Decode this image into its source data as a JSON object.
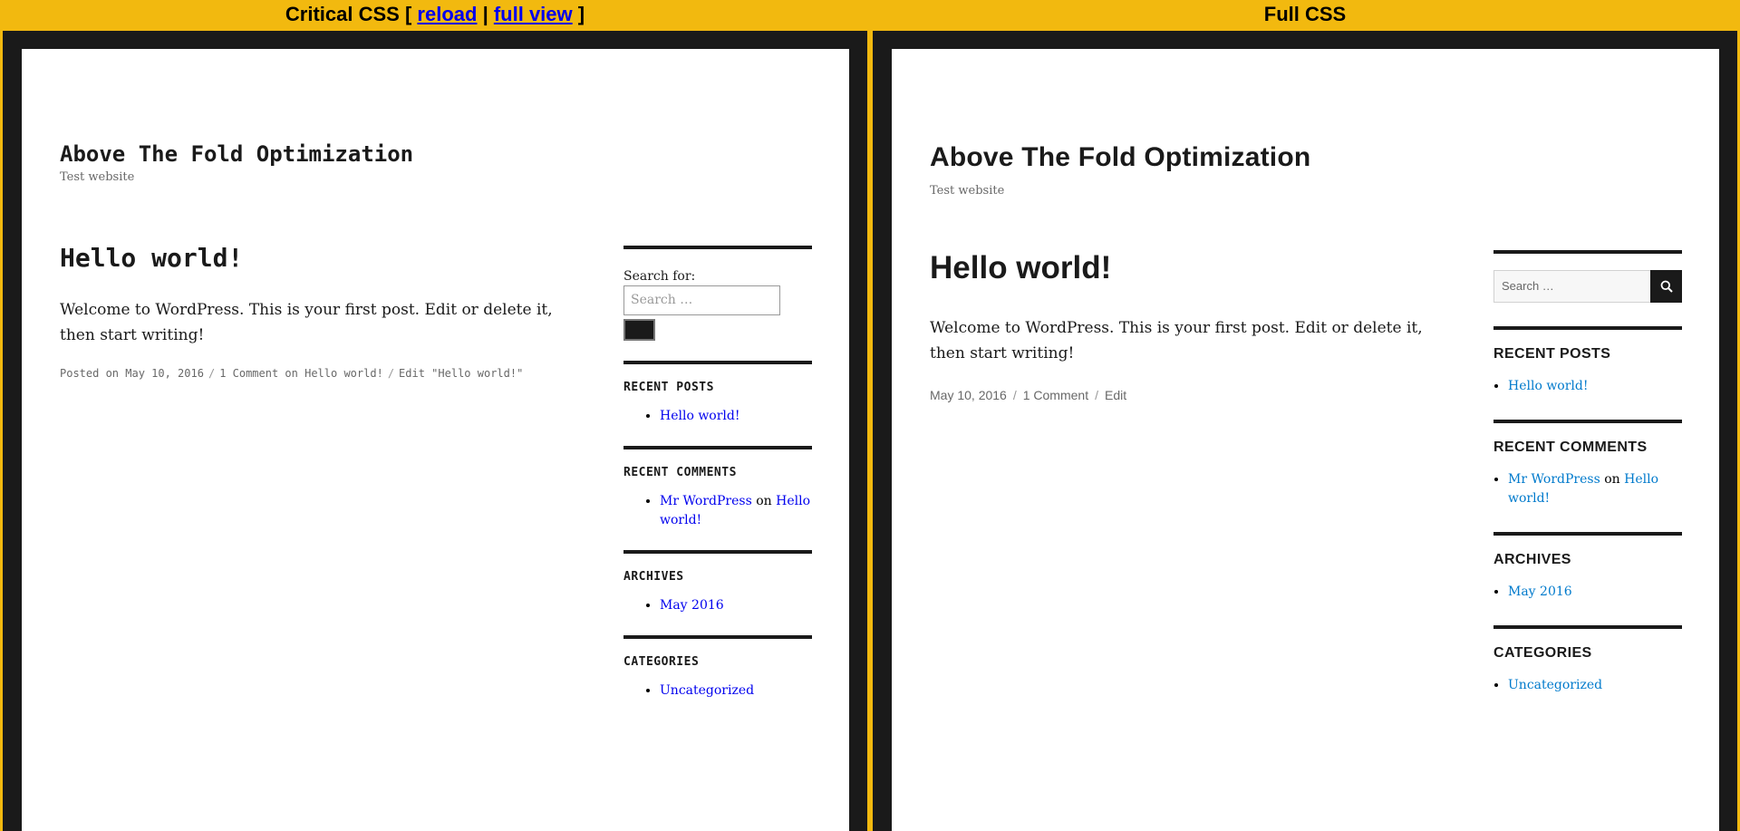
{
  "topbar": {
    "critical_prefix": "Critical CSS [",
    "reload_link": "reload",
    "divider": "|",
    "full_view_link": "full view",
    "critical_suffix": "]",
    "full_label": "Full CSS"
  },
  "site": {
    "title": "Above The Fold Optimization",
    "description": "Test website"
  },
  "post": {
    "title": "Hello world!",
    "content": "Welcome to WordPress. This is your first post. Edit or delete it, then start writing!"
  },
  "left_footer": {
    "posted_on": "Posted on May 10, 2016",
    "sep": "/",
    "comments": "1 Comment on Hello world!",
    "edit": "Edit \"Hello world!\""
  },
  "right_footer": {
    "date": "May 10, 2016",
    "sep": "/",
    "comments": "1 Comment",
    "edit": "Edit"
  },
  "sidebar": {
    "search_label": "Search for:",
    "search_placeholder": "Search …",
    "recent_posts_title_left": "RECENT POSTS",
    "recent_posts_title_right": "RECENT POSTS",
    "recent_post_1": "Hello world!",
    "recent_comments_title_left": "RECENT COMMENTS",
    "recent_comments_title_right": "RECENT COMMENTS",
    "comment_author": "Mr WordPress",
    "comment_on": "on",
    "comment_post": "Hello world!",
    "archives_title_left": "ARCHIVES",
    "archives_title_right": "ARCHIVES",
    "archive_1": "May 2016",
    "categories_title_left": "CATEGORIES",
    "categories_title_right": "CATEGORIES",
    "category_1": "Uncategorized"
  },
  "icons": {
    "search_button": "search-icon"
  },
  "colors": {
    "accent_bar": "#f2b90f",
    "frame": "#1a1a1a",
    "link_left": "#0000ee",
    "link_right": "#007acc"
  }
}
